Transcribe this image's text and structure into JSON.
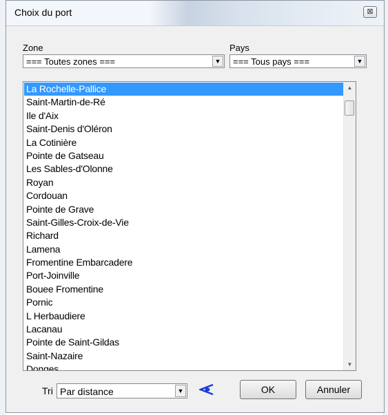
{
  "window": {
    "title": "Choix du port",
    "close_glyph": "⊠"
  },
  "zone": {
    "label": "Zone",
    "selected": "=== Toutes zones ==="
  },
  "pays": {
    "label": "Pays",
    "selected": "=== Tous pays ==="
  },
  "ports": {
    "selected_index": 0,
    "items": [
      "La Rochelle-Pallice",
      "Saint-Martin-de-Ré",
      "Ile d'Aix",
      "Saint-Denis d'Oléron",
      "La Cotinière",
      "Pointe de Gatseau",
      "Les Sables-d'Olonne",
      "Royan",
      "Cordouan",
      "Pointe de Grave",
      "Saint-Gilles-Croix-de-Vie",
      "Richard",
      "Lamena",
      "Fromentine Embarcadere",
      "Port-Joinville",
      "Bouee Fromentine",
      "Pornic",
      "L Herbaudiere",
      "Lacanau",
      "Pointe de Saint-Gildas",
      "Saint-Nazaire",
      "Donges"
    ]
  },
  "sort": {
    "label": "Tri",
    "selected": "Par distance"
  },
  "buttons": {
    "ok": "OK",
    "cancel": "Annuler"
  },
  "icons": {
    "view": "eye-icon",
    "dropdown": "chevron-down-icon"
  },
  "colors": {
    "selection": "#3399ff",
    "eye": "#1a3ad6"
  }
}
